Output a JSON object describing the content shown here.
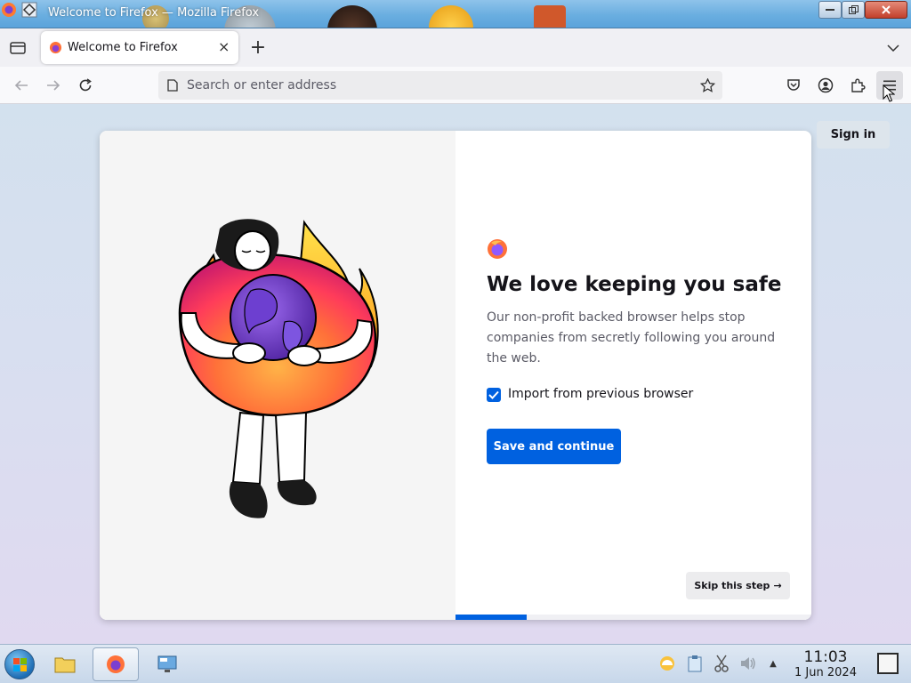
{
  "window": {
    "title": "Welcome to Firefox — Mozilla Firefox"
  },
  "tabs": [
    {
      "label": "Welcome to Firefox",
      "close": "×"
    }
  ],
  "tabstrip": {
    "new_tab": "+"
  },
  "navbar": {
    "url_placeholder": "Search or enter address"
  },
  "page": {
    "sign_in": "Sign in",
    "headline": "We love keeping you safe",
    "subtext": "Our non-profit backed browser helps stop companies from secretly following you around the web.",
    "checkbox_label": "Import from previous browser",
    "checkbox_checked": true,
    "primary_button": "Save and continue",
    "skip_button": "Skip this step",
    "skip_arrow": "→",
    "progress": 0.2
  },
  "taskbar": {
    "time": "11:03",
    "date": "1 Jun 2024",
    "tray_up_arrow": "▲"
  },
  "colors": {
    "accent": "#0061e0",
    "titlebar": "#6aaee0",
    "content_bg": "#d8dff0",
    "card_left_bg": "#f5f5f5"
  },
  "icons": {
    "titlebar": [
      "firefox-icon",
      "app-menu-icon"
    ],
    "tab": [
      "firefox-tab-icon",
      "close-icon"
    ],
    "navbar": [
      "back-arrow-icon",
      "forward-arrow-icon",
      "reload-icon",
      "page-icon",
      "bookmark-star-icon",
      "pocket-icon",
      "account-icon",
      "extensions-icon",
      "hamburger-menu-icon"
    ],
    "taskbar": [
      "start-orb-icon",
      "file-manager-icon",
      "firefox-taskbar-icon",
      "network-desktop-icon",
      "weather-icon",
      "clipboard-icon",
      "scissors-icon",
      "volume-icon",
      "show-desktop-icon"
    ]
  }
}
